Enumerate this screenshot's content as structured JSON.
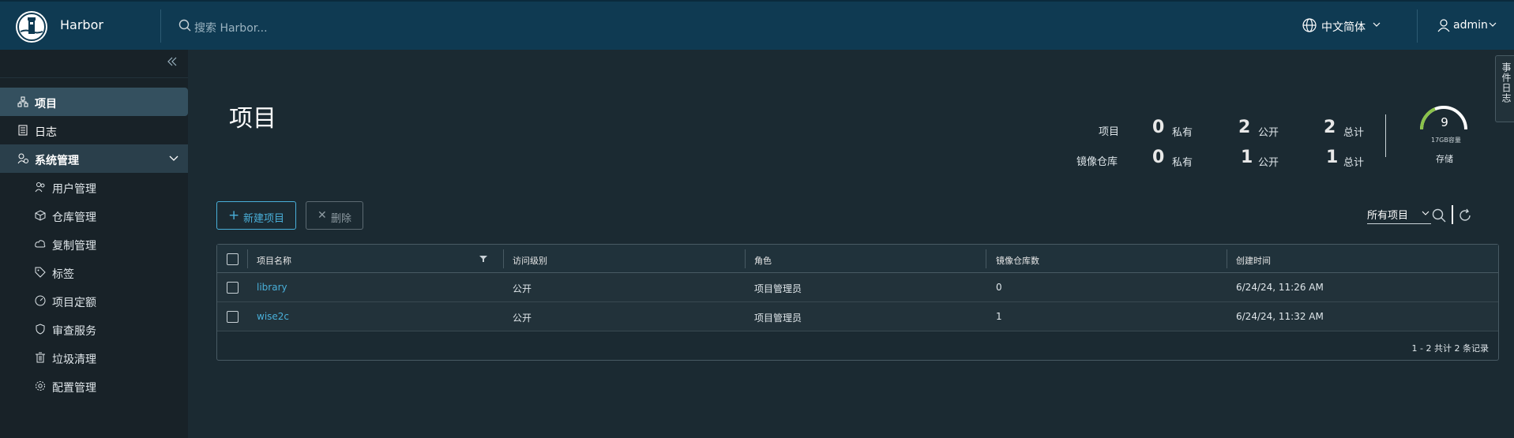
{
  "header": {
    "brand": "Harbor",
    "search_placeholder": "搜索 Harbor...",
    "language": "中文简体",
    "user": "admin"
  },
  "sidebar": {
    "items": [
      {
        "label": "项目",
        "icon": "projects-icon",
        "active": true
      },
      {
        "label": "日志",
        "icon": "logs-icon"
      },
      {
        "label": "系统管理",
        "icon": "admin-icon",
        "expanded": true
      }
    ],
    "sub_items": [
      {
        "label": "用户管理",
        "icon": "users-icon"
      },
      {
        "label": "仓库管理",
        "icon": "registries-icon"
      },
      {
        "label": "复制管理",
        "icon": "replication-icon"
      },
      {
        "label": "标签",
        "icon": "tag-icon"
      },
      {
        "label": "项目定额",
        "icon": "quota-icon"
      },
      {
        "label": "审查服务",
        "icon": "shield-icon"
      },
      {
        "label": "垃圾清理",
        "icon": "trash-icon"
      },
      {
        "label": "配置管理",
        "icon": "gear-icon"
      }
    ]
  },
  "main": {
    "title": "项目",
    "stats": {
      "rows": [
        {
          "label": "项目",
          "private": "0",
          "public": "2",
          "total": "2"
        },
        {
          "label": "镜像仓库",
          "private": "0",
          "public": "1",
          "total": "1"
        }
      ],
      "private_label": "私有",
      "public_label": "公开",
      "total_label": "总计"
    },
    "storage": {
      "value": "9",
      "capacity": "17GB容量",
      "label": "存储"
    },
    "toolbar": {
      "new_label": "新建项目",
      "delete_label": "删除",
      "filter_value": "所有项目"
    },
    "table": {
      "columns": [
        "项目名称",
        "访问级别",
        "角色",
        "镜像仓库数",
        "创建时间"
      ],
      "rows": [
        {
          "name": "library",
          "access": "公开",
          "role": "项目管理员",
          "repos": "0",
          "created": "6/24/24, 11:26 AM"
        },
        {
          "name": "wise2c",
          "access": "公开",
          "role": "项目管理员",
          "repos": "1",
          "created": "6/24/24, 11:32 AM"
        }
      ],
      "footer": "1 - 2 共计 2 条记录"
    },
    "side_tab": "事件日志"
  },
  "colors": {
    "header_bg": "#0f3a52",
    "sidebar_bg": "#182228",
    "main_bg": "#1b2a32",
    "accent": "#49afd9"
  }
}
